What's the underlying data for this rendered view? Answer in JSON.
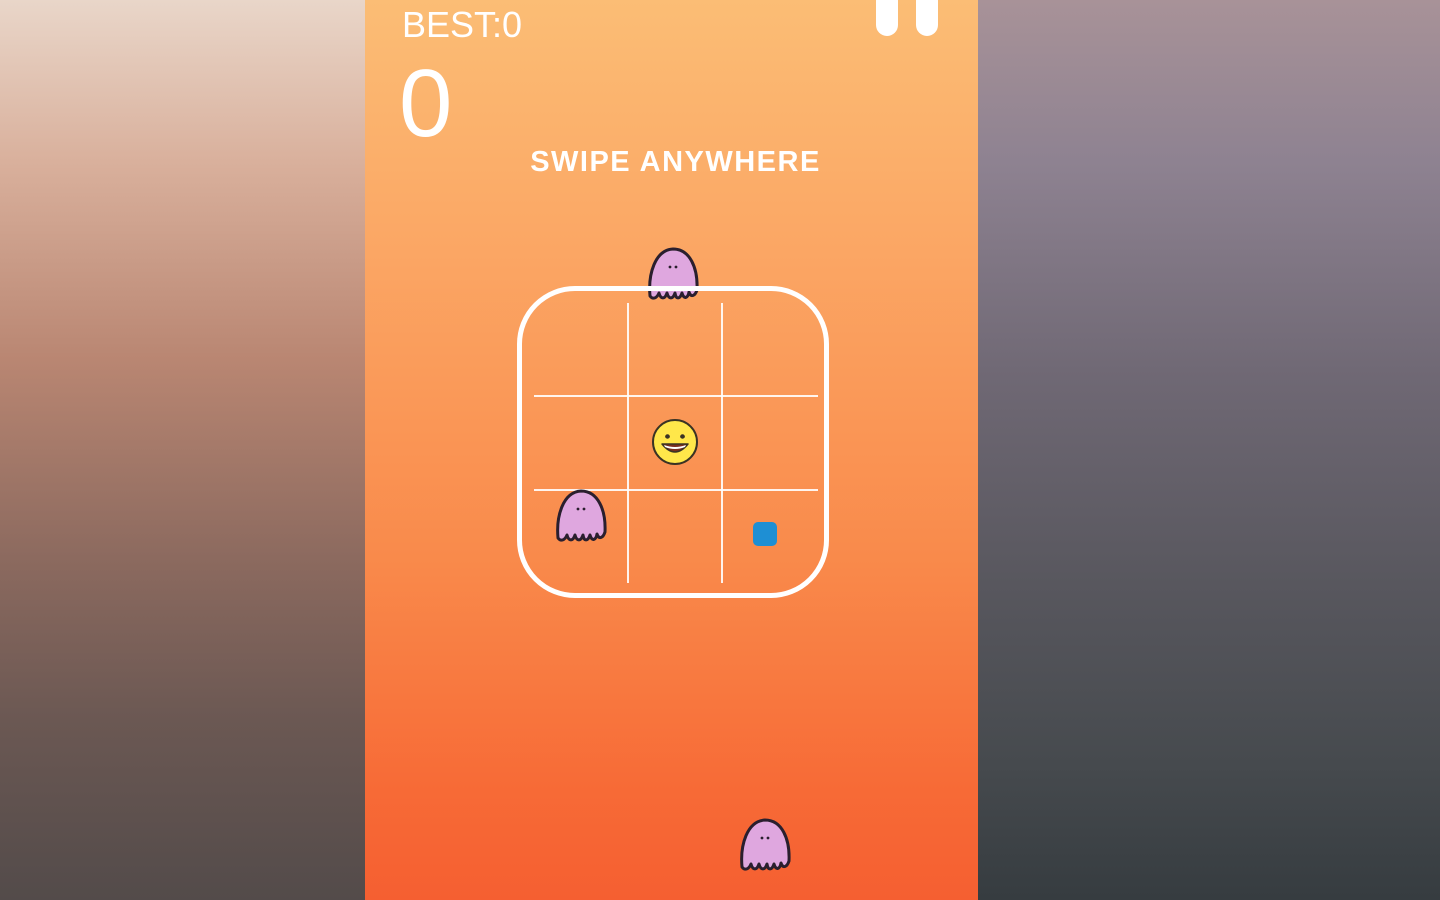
{
  "hud": {
    "best_label": "BEST:0",
    "score": "0",
    "hint": "SWIPE ANYWHERE"
  },
  "board": {
    "rows": 3,
    "cols": 3,
    "player": {
      "icon": "smiley-face-icon",
      "row": 1,
      "col": 1
    },
    "gem": {
      "icon": "blue-square-gem-icon",
      "row": 2,
      "col": 2,
      "color": "#1e8fd4"
    }
  },
  "enemies": [
    {
      "icon": "pink-ghost-icon",
      "where": "above board, top-middle edge"
    },
    {
      "icon": "pink-ghost-icon",
      "where": "board cell row 2, col 0"
    },
    {
      "icon": "pink-ghost-icon",
      "where": "bottom of screen"
    }
  ],
  "colors": {
    "background_top": "#fbbd75",
    "background_bottom": "#f55f31",
    "ghost_fill": "#dfa7df",
    "ghost_outline": "#2a1f2e",
    "smiley_fill": "#ffe74a",
    "board_line": "#ffffff"
  }
}
